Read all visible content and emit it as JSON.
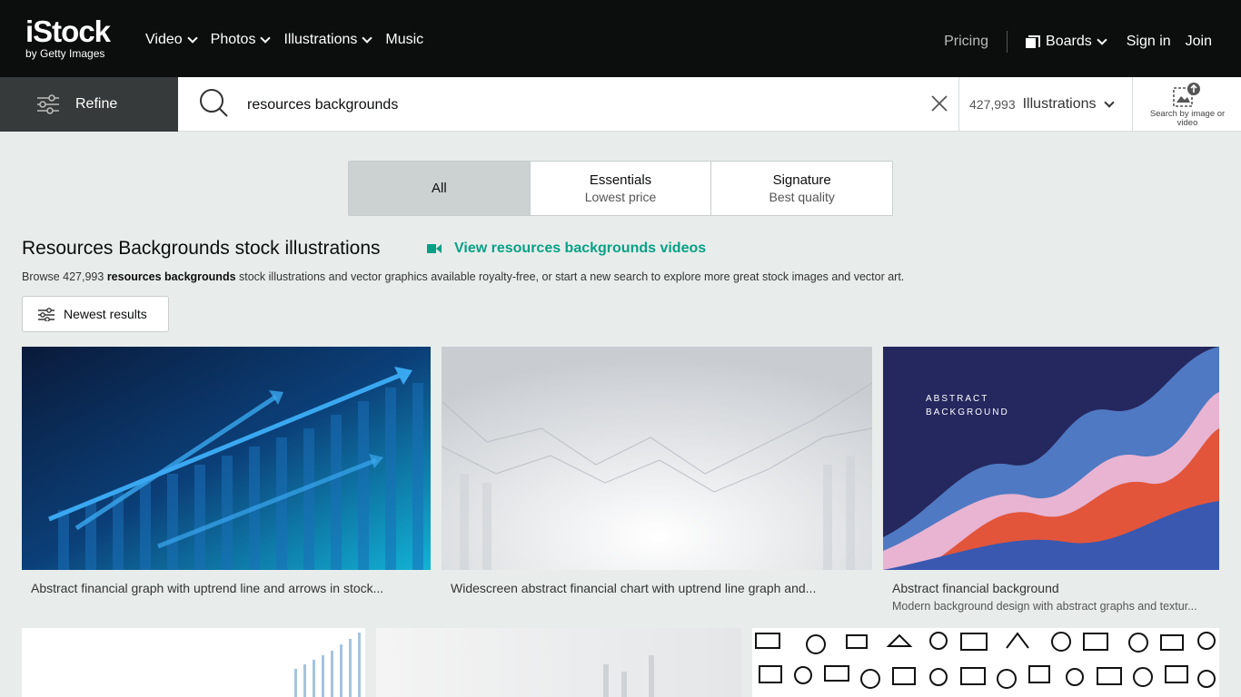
{
  "header": {
    "logo": {
      "main": "iStock",
      "sub": "by Getty Images"
    },
    "nav": [
      {
        "label": "Video",
        "dropdown": true
      },
      {
        "label": "Photos",
        "dropdown": true
      },
      {
        "label": "Illustrations",
        "dropdown": true
      },
      {
        "label": "Music",
        "dropdown": false
      }
    ],
    "pricing": "Pricing",
    "boards": "Boards",
    "signin": "Sign in",
    "join": "Join"
  },
  "search": {
    "refine_label": "Refine",
    "query": "resources backgrounds",
    "result_count": "427,993",
    "type_label": "Illustrations",
    "image_search_label": "Search by image or video"
  },
  "tabs": [
    {
      "title": "All",
      "sub": "",
      "active": true
    },
    {
      "title": "Essentials",
      "sub": "Lowest price",
      "active": false
    },
    {
      "title": "Signature",
      "sub": "Best quality",
      "active": false
    }
  ],
  "results": {
    "title": "Resources Backgrounds stock illustrations",
    "video_link": "View resources backgrounds videos",
    "desc_prefix": "Browse 427,993 ",
    "desc_bold": "resources backgrounds",
    "desc_suffix": " stock illustrations and vector graphics available royalty-free, or start a new search to explore more great stock images and vector art.",
    "sort_label": "Newest results"
  },
  "cards": [
    {
      "caption": "Abstract financial graph with uptrend line and arrows in stock...",
      "subcaption": ""
    },
    {
      "caption": "Widescreen abstract financial chart with uptrend line graph and...",
      "subcaption": ""
    },
    {
      "caption": "Abstract financial background",
      "subcaption": "Modern background design with abstract graphs and textur...",
      "overlay_text": "ABSTRACT\nBACKGROUND"
    }
  ],
  "colors": {
    "brand_dark": "#0c0d0d",
    "accent_green": "#08a085",
    "page_bg": "#e8edec"
  }
}
